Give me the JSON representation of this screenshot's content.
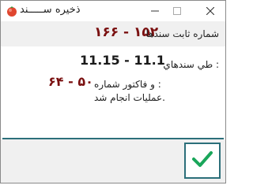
{
  "window": {
    "title": "ذخيره ســـــند"
  },
  "header": {
    "label": "شماره ثابت سندها",
    "range": "۱۶۶ - ۱۵۲"
  },
  "body": {
    "row1_label": "طي سندهاي :",
    "row1_range": "11.15 - 11.1",
    "row2_label": "و فاكتور شماره :",
    "row2_range": "۶۴ - ۵۰",
    "status_text": "عمليات انجام شد."
  },
  "colors": {
    "accent": "#2c6f7a",
    "number_red": "#7a1010",
    "check_green": "#1aa65a"
  },
  "icons": {
    "app": "tomato-icon",
    "ok": "checkmark-icon"
  }
}
